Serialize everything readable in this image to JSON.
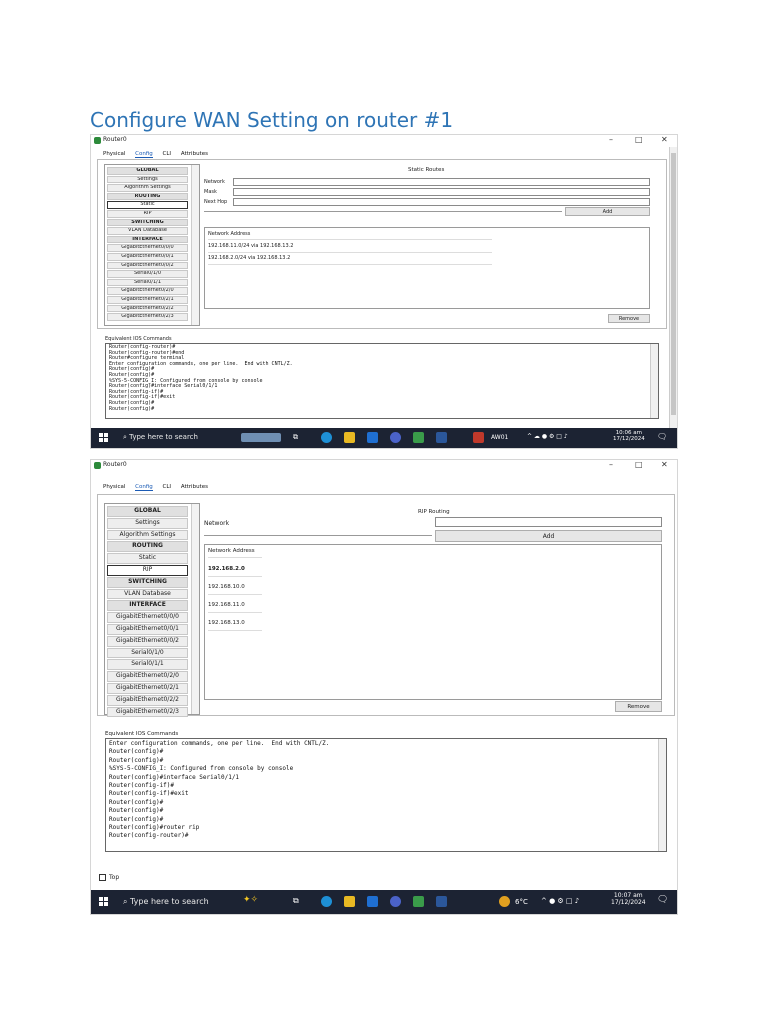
{
  "heading": "Configure WAN Setting on router #1",
  "colors": {
    "heading": "#2e74b5",
    "taskbar": "#1c2333",
    "selected_tab": "#1b5bb5"
  },
  "window": {
    "title": "Router0",
    "controls": {
      "minimize": "–",
      "maximize": "□",
      "close": "✕"
    },
    "tabs": [
      "Physical",
      "Config",
      "CLI",
      "Attributes"
    ],
    "active_tab": "Config"
  },
  "screenshot1": {
    "sidebar": [
      "GLOBAL",
      "Settings",
      "Algorithm Settings",
      "ROUTING",
      "Static",
      "RIP",
      "SWITCHING",
      "VLAN Database",
      "INTERFACE",
      "GigabitEthernet0/0/0",
      "GigabitEthernet0/0/1",
      "GigabitEthernet0/0/2",
      "Serial0/1/0",
      "Serial0/1/1",
      "GigabitEthernet0/2/0",
      "GigabitEthernet0/2/1",
      "GigabitEthernet0/2/2",
      "GigabitEthernet0/2/3"
    ],
    "selected_item": "Static",
    "panel_title": "Static Routes",
    "fields": {
      "network": "Network",
      "mask": "Mask",
      "next_hop": "Next Hop"
    },
    "add_label": "Add",
    "list_header": "Network Address",
    "routes": [
      "192.168.11.0/24 via 192.168.13.2",
      "192.168.2.0/24 via 192.168.13.2"
    ],
    "remove_label": "Remove",
    "ios_label": "Equivalent IOS Commands",
    "console": [
      "Router(config-router)#",
      "Router(config-router)#end",
      "Router#configure terminal",
      "Enter configuration commands, one per line.  End with CNTL/Z.",
      "Router(config)#",
      "Router(config)#",
      "%SYS-5-CONFIG_I: Configured from console by console",
      "",
      "Router(config)#interface Serial0/1/1",
      "Router(config-if)#",
      "Router(config-if)#exit",
      "Router(config)#",
      "Router(config)#"
    ],
    "taskbar": {
      "search": "Type here to search",
      "weather": "AW01",
      "time": "10:06 am",
      "date": "17/12/2024"
    }
  },
  "screenshot2": {
    "sidebar": [
      "GLOBAL",
      "Settings",
      "Algorithm Settings",
      "ROUTING",
      "Static",
      "RIP",
      "SWITCHING",
      "VLAN Database",
      "INTERFACE",
      "GigabitEthernet0/0/0",
      "GigabitEthernet0/0/1",
      "GigabitEthernet0/0/2",
      "Serial0/1/0",
      "Serial0/1/1",
      "GigabitEthernet0/2/0",
      "GigabitEthernet0/2/1",
      "GigabitEthernet0/2/2",
      "GigabitEthernet0/2/3"
    ],
    "selected_item": "RIP",
    "panel_title": "RIP Routing",
    "network_label": "Network",
    "add_label": "Add",
    "list_header": "Network Address",
    "networks": [
      "192.168.2.0",
      "192.168.10.0",
      "192.168.11.0",
      "192.168.13.0"
    ],
    "remove_label": "Remove",
    "ios_label": "Equivalent IOS Commands",
    "console": [
      "Enter configuration commands, one per line.  End with CNTL/Z.",
      "Router(config)#",
      "Router(config)#",
      "%SYS-5-CONFIG_I: Configured from console by console",
      "",
      "Router(config)#interface Serial0/1/1",
      "Router(config-if)#",
      "Router(config-if)#exit",
      "Router(config)#",
      "Router(config)#",
      "Router(config)#",
      "Router(config)#router rip",
      "Router(config-router)#"
    ],
    "top_label": "Top",
    "taskbar": {
      "search": "Type here to search",
      "weather": "6°C",
      "time": "10:07 am",
      "date": "17/12/2024"
    }
  }
}
